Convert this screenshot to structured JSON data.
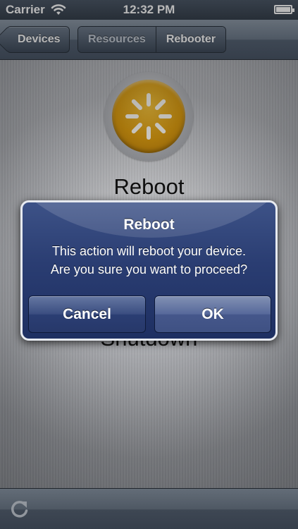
{
  "status_bar": {
    "carrier": "Carrier",
    "time": "12:32 PM",
    "wifi_icon": "wifi-icon",
    "battery_icon": "battery-icon"
  },
  "nav_bar": {
    "back_label": "Devices",
    "segments": [
      {
        "label": "Resources",
        "selected": false
      },
      {
        "label": "Rebooter",
        "selected": true
      }
    ]
  },
  "actions": [
    {
      "label": "Reboot",
      "icon": "spinner-icon",
      "color": "#e0a01a"
    },
    {
      "label": "Shutdown",
      "icon": "power-icon",
      "color": "#c4231d"
    }
  ],
  "alert": {
    "title": "Reboot",
    "message_line1": "This action will reboot your device.",
    "message_line2": "Are you sure you want to proceed?",
    "cancel_label": "Cancel",
    "ok_label": "OK"
  },
  "toolbar": {
    "refresh_icon": "refresh-icon"
  }
}
